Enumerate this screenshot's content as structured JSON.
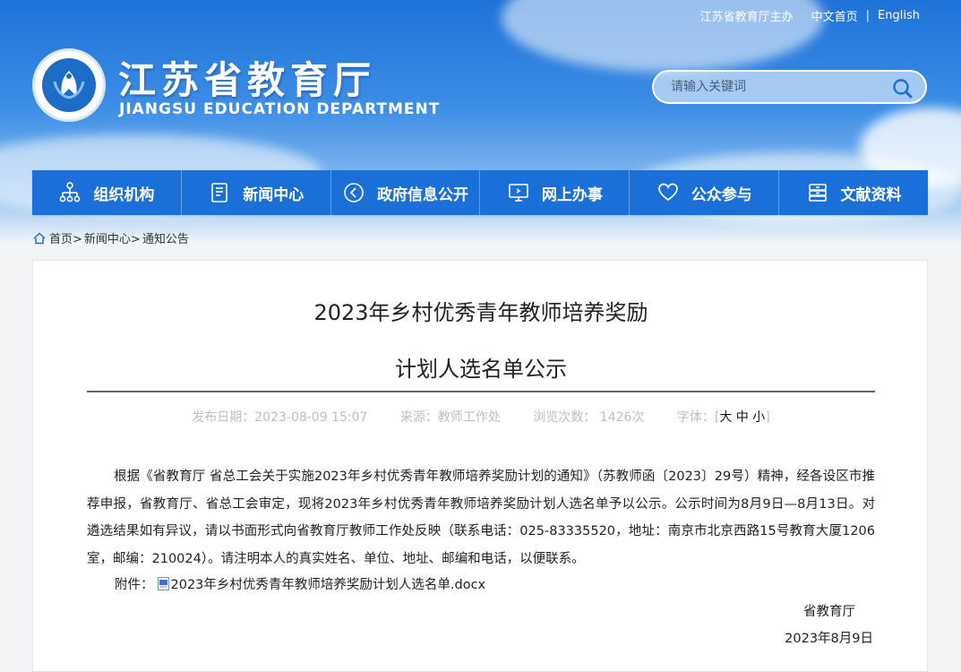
{
  "top_links": {
    "sponsor": "江苏省教育厅主办",
    "home_cn": "中文首页",
    "separator": "|",
    "english": "English"
  },
  "site": {
    "title_zh": "江苏省教育厅",
    "title_en": "JIANGSU EDUCATION DEPARTMENT"
  },
  "search": {
    "placeholder": "请输入关键词"
  },
  "nav": [
    {
      "label": "组织机构",
      "icon": "org-chart-icon"
    },
    {
      "label": "新闻中心",
      "icon": "document-icon"
    },
    {
      "label": "政府信息公开",
      "icon": "play-circle-icon"
    },
    {
      "label": "网上办事",
      "icon": "monitor-icon"
    },
    {
      "label": "公众参与",
      "icon": "heart-icon"
    },
    {
      "label": "文献资料",
      "icon": "archive-icon"
    }
  ],
  "breadcrumb": {
    "home": "首页>",
    "news": "新闻中心>",
    "current": "通知公告"
  },
  "article": {
    "title_line1": "2023年乡村优秀青年教师培养奖励",
    "title_line2": "计划人选名单公示",
    "publish": "发布日期：2023-08-09 15:07",
    "source": "来源：教师工作处",
    "views": "浏览次数： 1426次",
    "font_label": "字体：[",
    "font_sizes": "大 中 小",
    "font_close": "]",
    "body": "根据《省教育厅 省总工会关于实施2023年乡村优秀青年教师培养奖励计划的通知》（苏教师函〔2023〕29号）精神，经各设区市推荐申报，省教育厅、省总工会审定，现将2023年乡村优秀青年教师培养奖励计划人选名单予以公示。公示时间为8月9日—8月13日。对遴选结果如有异议，请以书面形式向省教育厅教师工作处反映（联系电话：025-83335520，地址：南京市北京西路15号教育大厦1206室，邮编：210024）。请注明本人的真实姓名、单位、地址、邮编和电话，以便联系。",
    "attachment_label": "附件：",
    "attachment_file": "2023年乡村优秀青年教师培养奖励计划人选名单.docx",
    "signature": "省教育厅",
    "date": "2023年8月9日"
  },
  "colors": {
    "nav_bg": "#1a6fd9",
    "header_top": "#1f72d8"
  }
}
